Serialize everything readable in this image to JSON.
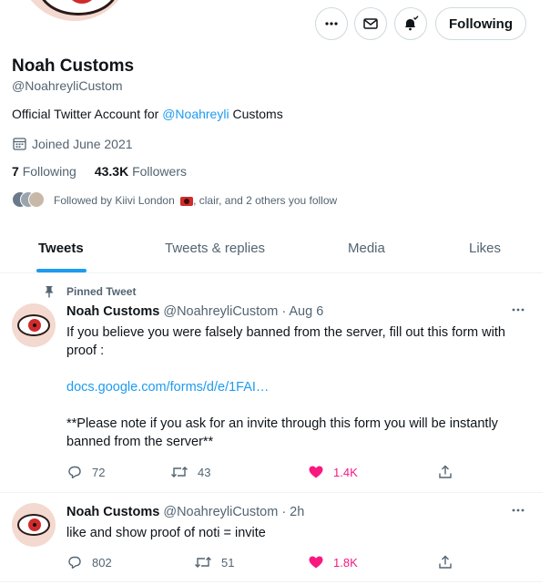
{
  "profile": {
    "name": "Noah Customs",
    "handle": "@NoahreyliCustom",
    "bio_prefix": "Official Twitter Account for ",
    "bio_link": "@Noahreyli",
    "bio_suffix": " Customs",
    "joined": "Joined June 2021",
    "following_count": "7",
    "following_label": "Following",
    "followers_count": "43.3K",
    "followers_label": "Followers",
    "followed_by_prefix": "Followed by Kiivi London",
    "followed_by_suffix": ", clair, and 2 others you follow"
  },
  "header_buttons": {
    "more_icon": "more-icon",
    "message_icon": "mail-icon",
    "notify_icon": "bell-check-icon",
    "follow_label": "Following"
  },
  "tabs": [
    {
      "label": "Tweets",
      "active": true
    },
    {
      "label": "Tweets & replies"
    },
    {
      "label": "Media"
    },
    {
      "label": "Likes"
    }
  ],
  "pinned_label": "Pinned Tweet",
  "tweets": [
    {
      "name": "Noah Customs",
      "meta": "@NoahreyliCustom · Aug 6",
      "line1": "If you believe you were falsely banned from the server, fill out this form with proof :",
      "link": "docs.google.com/forms/d/e/1FAI…",
      "line3": "**Please note if you ask for an invite through this form you will be instantly banned from the server**",
      "replies": "72",
      "retweets": "43",
      "likes": "1.4K"
    },
    {
      "name": "Noah Customs",
      "meta": "@NoahreyliCustom · 2h",
      "line1": "like and show proof of noti = invite",
      "replies": "802",
      "retweets": "51",
      "likes": "1.8K"
    }
  ],
  "colors": {
    "accent": "#1d9bf0",
    "like": "#f91880",
    "muted": "#536471"
  }
}
